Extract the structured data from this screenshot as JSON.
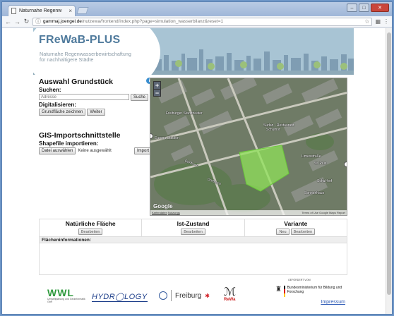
{
  "browser": {
    "tab_title": "Naturnahe Regenw",
    "url_host": "gammaj.joengel.de",
    "url_path": "/nutzewa/frontend/index.php?page=simulation_wasserbilanz&reset=1"
  },
  "header": {
    "logo": "FReWaB-PLUS",
    "tagline": "Naturnahe Regenwasserbewirtschaftung für nachhaltigere Städte"
  },
  "left_panel": {
    "title": "Auswahl Grundstück",
    "search_label": "Suchen:",
    "search_placeholder": "Adresse",
    "search_button": "Suche",
    "digitize_label": "Digitalisieren:",
    "draw_button": "Grundfläche zeichnen",
    "next_button": "Weiter",
    "gis_title": "GIS-Importschnittstelle",
    "shapefile_label": "Shapefile importieren:",
    "choose_file_button": "Datei auswählen",
    "no_file_text": "Keine ausgewählt",
    "import_button": "Import"
  },
  "map": {
    "zoom_in": "+",
    "zoom_out": "−",
    "labels": [
      "Freiburger Stadttheater",
      "Europa-Stadion",
      "Sudan - Restaurant",
      "Schulhof",
      "Dorfbach",
      "Dorfbach",
      "Limesstraße",
      "St. Pius",
      "Schul-hof",
      "Sonnenhaus"
    ],
    "google_logo": "Google",
    "attribution_left": "Kartendaten",
    "attribution_left_link": "Nutzungs",
    "attribution_right": "Terms of Use Google Maps Report"
  },
  "compare": {
    "columns": [
      {
        "title": "Natürliche Fläche",
        "buttons": [
          "Bearbeiten"
        ]
      },
      {
        "title": "Ist-Zustand",
        "buttons": [
          "Bearbeiten"
        ]
      },
      {
        "title": "Variante",
        "buttons": [
          "Neu",
          "Bearbeiten"
        ]
      }
    ],
    "info_label": "Flächeninformationen:"
  },
  "sponsors": {
    "wwl": "WWL",
    "wwl_sub": "Umweltplanung und Geoinformatik GbR",
    "hydrology": "HYDR◯LOGY",
    "freiburg": "Freiburg",
    "rewa": "ReWa",
    "bmbf_gefoerdert": "GEFÖRDERT VOM",
    "bmbf_name": "Bundesministerium für Bildung und Forschung"
  },
  "footer": {
    "impressum": "Impressum"
  },
  "colors": {
    "logo": "#4f7a9c",
    "banner": "#a8c4d4",
    "highlight_area": "#8fe25a",
    "link": "#2b58b5"
  }
}
